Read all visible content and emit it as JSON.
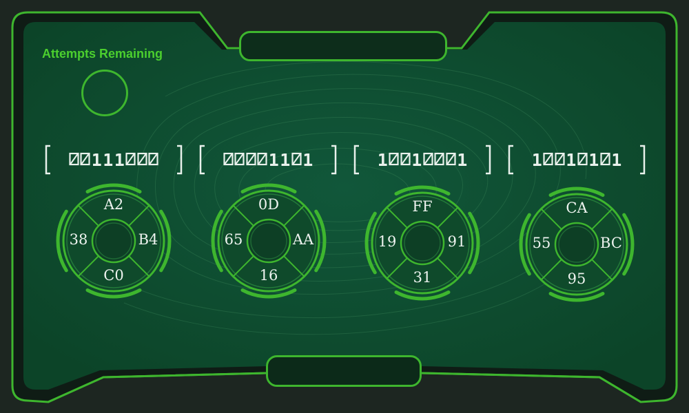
{
  "hud": {
    "attempts_label": "Attempts Remaining"
  },
  "codes": [
    {
      "bits": [
        "0",
        "0",
        "1",
        "1",
        "1",
        "0",
        "0",
        "0"
      ]
    },
    {
      "bits": [
        "0",
        "0",
        "0",
        "0",
        "1",
        "1",
        "0",
        "1"
      ]
    },
    {
      "bits": [
        "1",
        "0",
        "0",
        "1",
        "0",
        "0",
        "0",
        "1"
      ]
    },
    {
      "bits": [
        "1",
        "0",
        "0",
        "1",
        "0",
        "1",
        "0",
        "1"
      ]
    }
  ],
  "dials": [
    {
      "top": "A2",
      "right": "B4",
      "bottom": "C0",
      "left": "38"
    },
    {
      "top": "0D",
      "right": "AA",
      "bottom": "16",
      "left": "65"
    },
    {
      "top": "FF",
      "right": "91",
      "bottom": "31",
      "left": "19"
    },
    {
      "top": "CA",
      "right": "BC",
      "bottom": "95",
      "left": "55"
    }
  ],
  "colors": {
    "accent": "#3eb62e",
    "panel": "#0e4a2c",
    "text": "#eef3ef"
  }
}
